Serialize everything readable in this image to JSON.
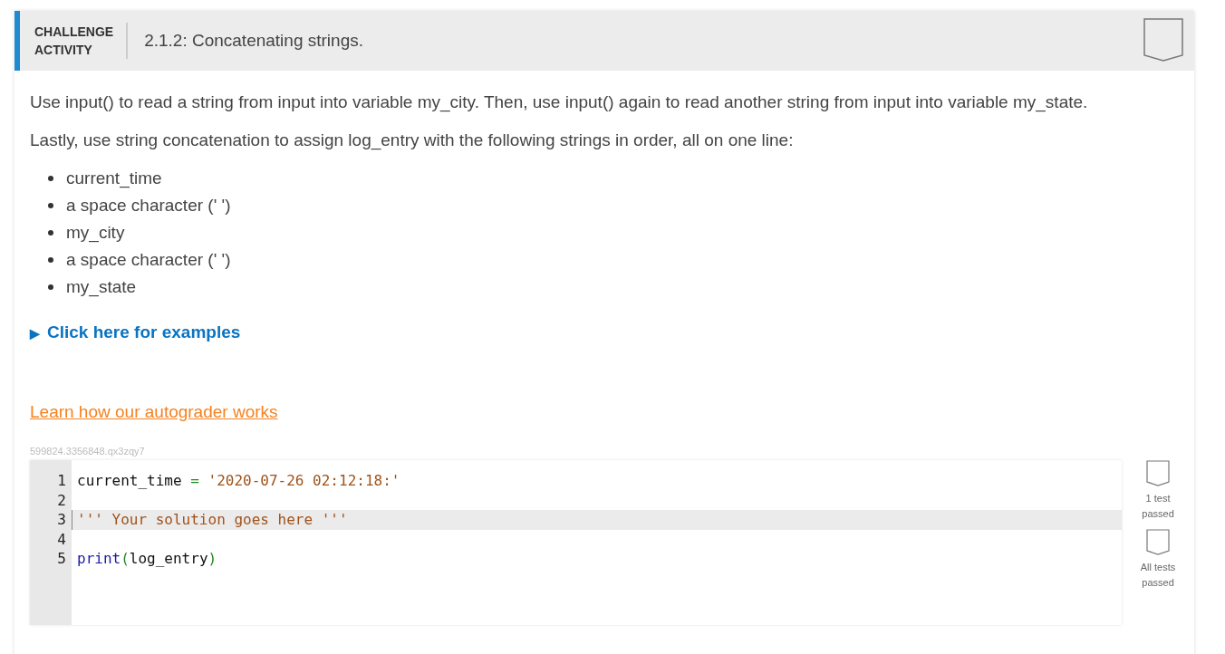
{
  "header": {
    "label_lines": [
      "CHALLENGE",
      "ACTIVITY"
    ],
    "title": "2.1.2: Concatenating strings."
  },
  "paragraphs": [
    "Use input() to read a string from input into variable my_city. Then, use input() again to read another string from input into variable my_state.",
    "Lastly, use string concatenation to assign log_entry with the following strings in order, all on one line:"
  ],
  "bullets": [
    "current_time",
    "a space character (' ')",
    "my_city",
    "a space character (' ')",
    "my_state"
  ],
  "examples_toggle": {
    "icon": "▶",
    "label": "Click here for examples",
    "expanded": false
  },
  "autograder_link": "Learn how our autograder works",
  "activity_id": "599824.3356848.qx3zqy7",
  "editor": {
    "lines": [
      {
        "number": "1",
        "active": false,
        "tokens": [
          {
            "kind": "name",
            "text": "current_time"
          },
          {
            "kind": "op",
            "text": " = "
          },
          {
            "kind": "string",
            "text": "'2020-07-26 02:12:18:'"
          }
        ]
      },
      {
        "number": "2",
        "active": false
      },
      {
        "number": "3",
        "active": true,
        "tokens": [
          {
            "kind": "string",
            "text": "''' Your solution goes here '''"
          }
        ]
      },
      {
        "number": "4",
        "active": false
      },
      {
        "number": "5",
        "active": false,
        "tokens": [
          {
            "kind": "builtin",
            "text": "print"
          },
          {
            "kind": "paren",
            "text": "("
          },
          {
            "kind": "name",
            "text": "log_entry"
          },
          {
            "kind": "paren",
            "text": ")"
          }
        ]
      }
    ]
  },
  "tests": [
    {
      "label_lines": [
        "1 test",
        "passed"
      ],
      "passed": false
    },
    {
      "label_lines": [
        "All tests",
        "passed"
      ],
      "passed": false
    }
  ]
}
